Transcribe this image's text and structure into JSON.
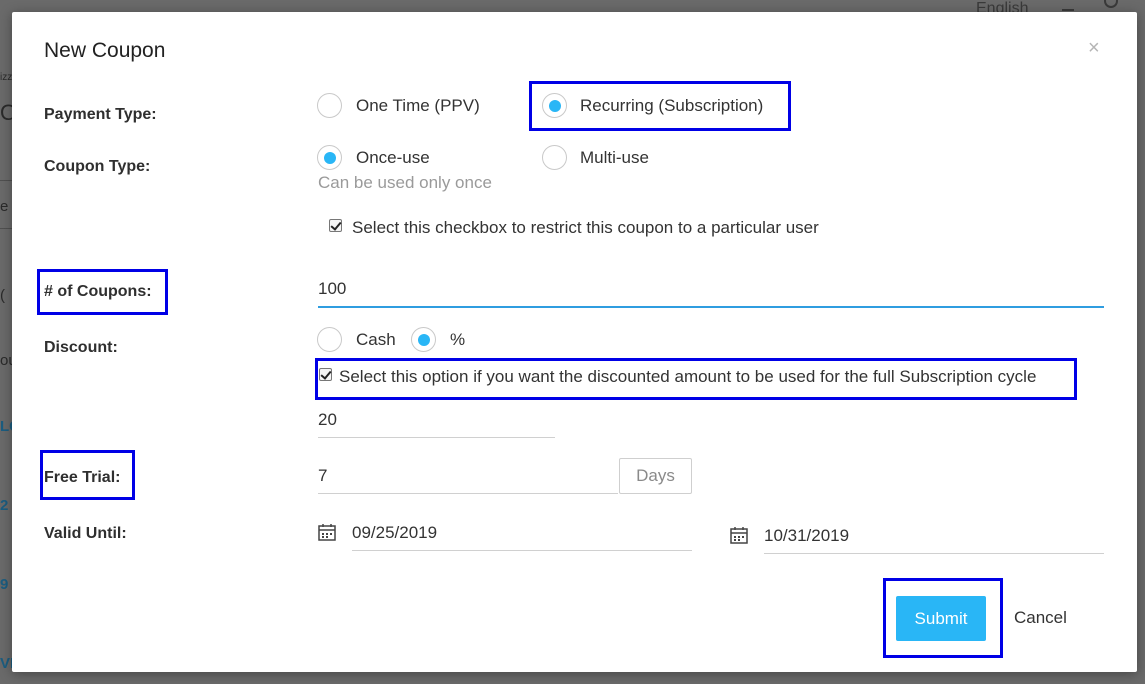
{
  "background": {
    "language": "English",
    "fragments": [
      "izz",
      "O",
      "e",
      "(",
      "ou",
      "LG",
      "2",
      "9",
      "VR"
    ]
  },
  "modal": {
    "title": "New Coupon",
    "close_icon": "×"
  },
  "payment_type": {
    "label": "Payment Type:",
    "options": [
      "One Time (PPV)",
      "Recurring (Subscription)"
    ],
    "selected": "Recurring (Subscription)"
  },
  "coupon_type": {
    "label": "Coupon Type:",
    "options": [
      "Once-use",
      "Multi-use"
    ],
    "selected": "Once-use",
    "hint": "Can be used only once"
  },
  "restrict_user": {
    "checked": true,
    "text": "Select this checkbox to restrict this coupon to a particular user"
  },
  "num_coupons": {
    "label": "# of Coupons:",
    "value": "100"
  },
  "discount": {
    "label": "Discount:",
    "options": [
      "Cash",
      "%"
    ],
    "selected": "%",
    "full_cycle_checked": true,
    "full_cycle_text": "Select this option if you want the discounted amount to be used for the full Subscription cycle",
    "value": "20"
  },
  "free_trial": {
    "label": "Free Trial:",
    "value": "7",
    "unit": "Days"
  },
  "valid_until": {
    "label": "Valid Until:",
    "start_date": "09/25/2019",
    "end_date": "10/31/2019"
  },
  "buttons": {
    "submit": "Submit",
    "cancel": "Cancel"
  },
  "colors": {
    "accent": "#29b6f6",
    "highlight": "#0000e6",
    "focus_underline": "#2f9de0"
  }
}
